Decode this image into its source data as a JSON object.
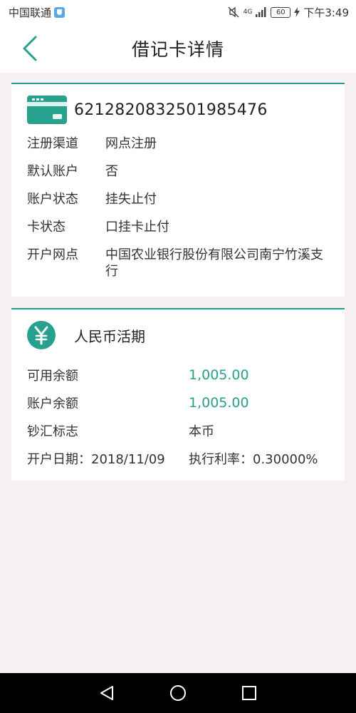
{
  "status_bar": {
    "carrier": "中国联通",
    "network": "4G",
    "battery": "60",
    "time": "下午3:49"
  },
  "header": {
    "title": "借记卡详情",
    "back_icon": "chevron-left-icon"
  },
  "card_info": {
    "card_number": "6212820832501985476",
    "rows": [
      {
        "label": "注册渠道",
        "value": "网点注册"
      },
      {
        "label": "默认账户",
        "value": "否"
      },
      {
        "label": "账户状态",
        "value": "挂失止付"
      },
      {
        "label": "卡状态",
        "value": "口挂卡止付"
      },
      {
        "label": "开户网点",
        "value": "中国农业银行股份有限公司南宁竹溪支行"
      }
    ]
  },
  "account": {
    "currency_title": "人民币活期",
    "available_label": "可用余额",
    "available_value": "1,005.00",
    "balance_label": "账户余额",
    "balance_value": "1,005.00",
    "cash_label": "钞汇标志",
    "cash_value": "本币",
    "open_date": "开户日期：2018/11/09",
    "rate": "执行利率：0.30000%"
  },
  "colors": {
    "accent": "#27a08e",
    "background": "#f5f1f5"
  }
}
